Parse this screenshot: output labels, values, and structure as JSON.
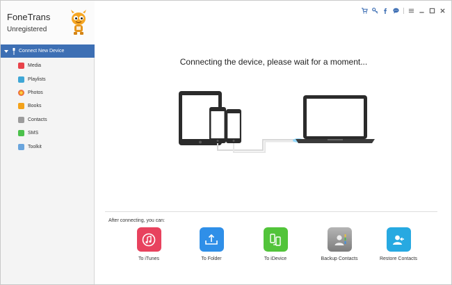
{
  "app": {
    "name": "FoneTrans",
    "status": "Unregistered"
  },
  "titlebar": {
    "icons": [
      "cart-icon",
      "key-icon",
      "facebook-icon",
      "chat-icon",
      "menu-icon",
      "minimize-icon",
      "maximize-icon",
      "close-icon"
    ]
  },
  "sidebar": {
    "device_label": "Connect New Device",
    "items": [
      {
        "label": "Media",
        "icon": "media-icon",
        "color": "#e8434a"
      },
      {
        "label": "Playlists",
        "icon": "playlists-icon",
        "color": "#3fa7d6"
      },
      {
        "label": "Photos",
        "icon": "photos-icon",
        "color": "#f08a24"
      },
      {
        "label": "Books",
        "icon": "books-icon",
        "color": "#f3a21b"
      },
      {
        "label": "Contacts",
        "icon": "contacts-icon",
        "color": "#9c9c9c"
      },
      {
        "label": "SMS",
        "icon": "sms-icon",
        "color": "#4cc14c"
      },
      {
        "label": "Toolkit",
        "icon": "toolkit-icon",
        "color": "#6aa5dd"
      }
    ]
  },
  "main": {
    "message": "Connecting the device, please wait for a moment...",
    "after_label": "After connecting, you can:",
    "actions": [
      {
        "label": "To iTunes",
        "icon": "itunes-icon",
        "color": "#e8425e"
      },
      {
        "label": "To Folder",
        "icon": "folder-upload-icon",
        "color": "#2f8fe8"
      },
      {
        "label": "To iDevice",
        "icon": "idevice-transfer-icon",
        "color": "#52c43a"
      },
      {
        "label": "Backup Contacts",
        "icon": "backup-contacts-icon",
        "color": "#8e8e8e"
      },
      {
        "label": "Restore Contacts",
        "icon": "restore-contacts-icon",
        "color": "#27a9e1"
      }
    ]
  }
}
